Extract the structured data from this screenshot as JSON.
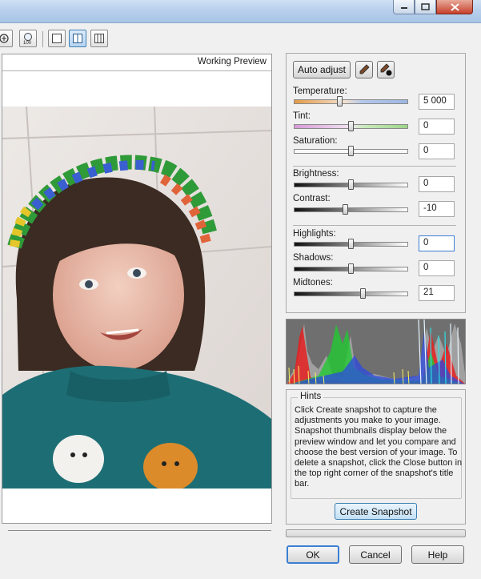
{
  "toolbar": {
    "buttons": [
      {
        "icon": "fit-to-window-icon"
      },
      {
        "icon": "zoom-100-icon",
        "label": "100"
      },
      {
        "icon": "single-view-icon"
      },
      {
        "icon": "split-view-vertical-icon"
      },
      {
        "icon": "split-view-side-icon"
      }
    ]
  },
  "preview": {
    "label": "Working Preview"
  },
  "adjust": {
    "auto_adjust": "Auto adjust",
    "temperature": {
      "label": "Temperature:",
      "value": "5 000",
      "level": 0.4
    },
    "tint": {
      "label": "Tint:",
      "value": "0",
      "level": 0.5
    },
    "saturation": {
      "label": "Saturation:",
      "value": "0",
      "level": 0.5
    },
    "brightness": {
      "label": "Brightness:",
      "value": "0",
      "level": 0.5
    },
    "contrast": {
      "label": "Contrast:",
      "value": "-10",
      "level": 0.45
    },
    "highlights": {
      "label": "Highlights:",
      "value": "0",
      "level": 0.5
    },
    "shadows": {
      "label": "Shadows:",
      "value": "0",
      "level": 0.5
    },
    "midtones": {
      "label": "Midtones:",
      "value": "21",
      "level": 0.6
    }
  },
  "hints": {
    "title": "Hints",
    "text": "Click Create snapshot to capture the adjustments you make to your image. Snapshot thumbnails display below the preview window and let you compare and choose the best version of your image. To delete a snapshot, click the Close button in the top right corner of the snapshot's title bar.",
    "create_snapshot": "Create Snapshot"
  },
  "dialog": {
    "ok": "OK",
    "cancel": "Cancel",
    "help": "Help"
  },
  "colors": {
    "accent_blue": "#3b7fd2",
    "close_red": "#c6412b"
  }
}
